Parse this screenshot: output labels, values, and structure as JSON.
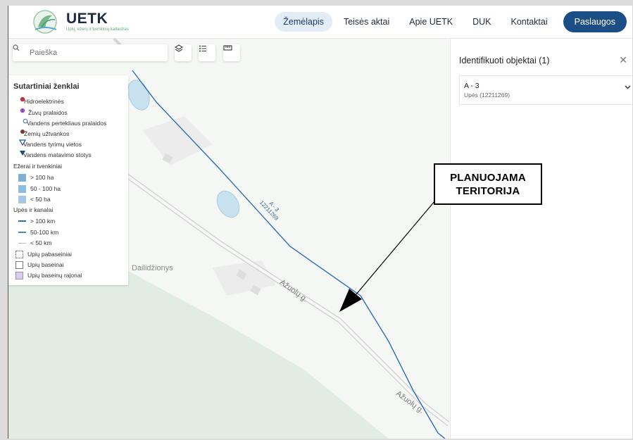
{
  "header": {
    "logo_title": "UETK",
    "logo_subtitle": "Upių, ežerų ir tvenkinių kadastras",
    "nav": [
      "Žemėlapis",
      "Teisės aktai",
      "Apie UETK",
      "DUK",
      "Kontaktai"
    ],
    "active_nav": "Žemėlapis",
    "services_button": "Paslaugos"
  },
  "search": {
    "placeholder": "Paieška"
  },
  "tools": [
    "layers-icon",
    "list-icon",
    "ruler-icon"
  ],
  "legend": {
    "title": "Sutartiniai ženklai",
    "points": [
      {
        "label": "Hidroelektrinės",
        "color": "#c0304a",
        "shape": "dot"
      },
      {
        "label": "Žuvų pralaidos",
        "color": "#9a4ec0",
        "shape": "dot"
      },
      {
        "label": "Vandens pertekliaus pralaidos",
        "color": "#3a6ab0",
        "shape": "ring"
      },
      {
        "label": "Žemių užtvankos",
        "color": "#7a3a30",
        "shape": "dot"
      },
      {
        "label": "Vandens tyrimų vietos",
        "color": "#2a4a9a",
        "shape": "triangle-outline"
      },
      {
        "label": "Vandens matavimo stotys",
        "color": "#2a4a7a",
        "shape": "triangle"
      }
    ],
    "lakes_heading": "Ežerai ir tvenkiniai",
    "lakes": [
      {
        "label": "> 100 ha",
        "color": "#7fb0d8"
      },
      {
        "label": "50 - 100 ha",
        "color": "#8fbce0"
      },
      {
        "label": "< 50 ha",
        "color": "#a5c8e4"
      }
    ],
    "rivers_heading": "Upės ir kanalai",
    "rivers": [
      {
        "label": "> 100 km",
        "color": "#2f6fb0"
      },
      {
        "label": "50-100 km",
        "color": "#4a8ac0"
      },
      {
        "label": "< 50 km",
        "color": "#9cc4dc"
      }
    ],
    "basins": [
      {
        "label": "Upių pabaseiniai",
        "style": "dashed"
      },
      {
        "label": "Upių baseinai",
        "style": "solid"
      },
      {
        "label": "Upių baseinų rajonai",
        "style": "filled"
      }
    ]
  },
  "map": {
    "place_label": "Dailidžionys",
    "road_labels": [
      "Ažuolų g.",
      "Ažuolų g."
    ],
    "river_label_name": "A - 3",
    "river_label_code": "12211269"
  },
  "callout": {
    "line1": "PLANUOJAMA",
    "line2": "TERITORIJA"
  },
  "panel": {
    "title": "Identifikuoti objektai (1)",
    "item_name": "A - 3",
    "item_sub": "Upės (12211269)"
  },
  "colors": {
    "brand": "#1c4e86",
    "river": "#2f6fb0",
    "forest": "#e3eee5"
  }
}
